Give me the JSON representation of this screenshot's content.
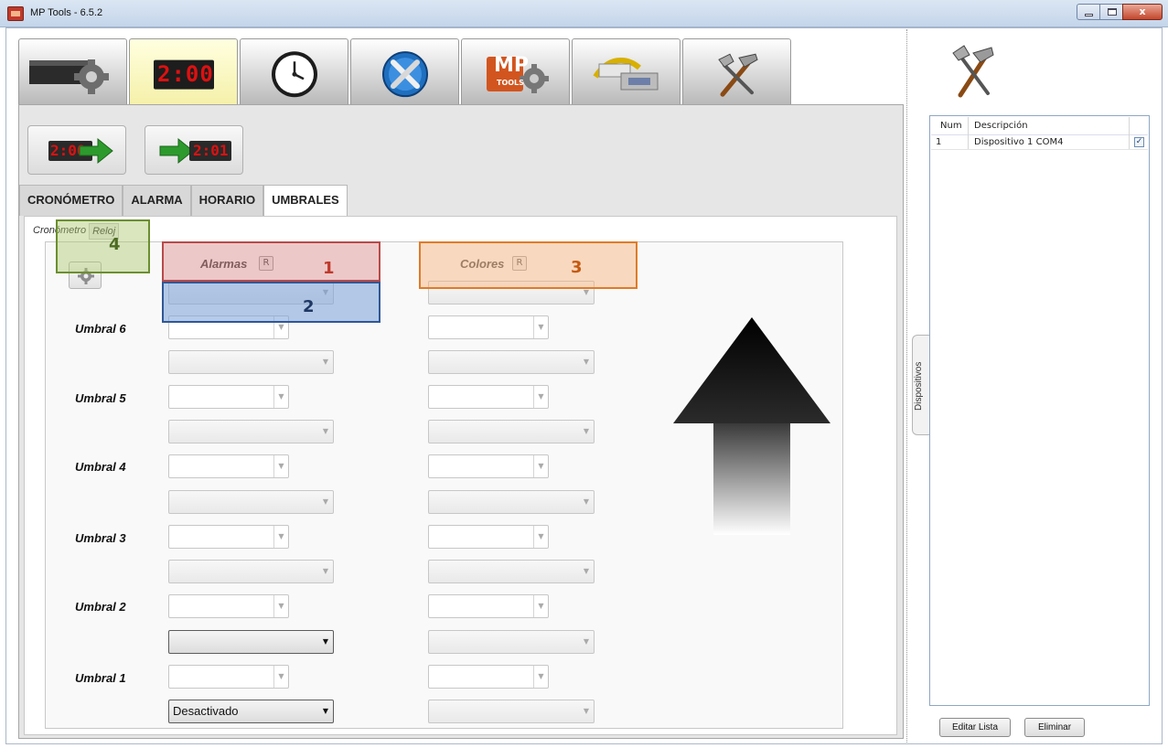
{
  "window": {
    "title": "MP Tools - 6.5.2",
    "close_glyph": "x"
  },
  "main_tabs": [
    {
      "name": "display-settings",
      "icon": "led-gear-icon"
    },
    {
      "name": "chronometer-display",
      "icon": "led-display-icon",
      "led_text": "2:00",
      "active": true
    },
    {
      "name": "clock",
      "icon": "clock-icon"
    },
    {
      "name": "tools",
      "icon": "wrench-screwdriver-icon"
    },
    {
      "name": "mp-tools",
      "icon": "mp-tools-logo-icon",
      "logo_text": "MP",
      "logo_sub": "TOOLS"
    },
    {
      "name": "connection",
      "icon": "serial-cable-icon"
    },
    {
      "name": "hammer",
      "icon": "hammer-icon"
    }
  ],
  "toolbar": {
    "left_led": "2:00",
    "right_led": "2:01"
  },
  "section_tabs": [
    {
      "label": "CRONÓMETRO"
    },
    {
      "label": "ALARMA"
    },
    {
      "label": "HORARIO"
    },
    {
      "label": "UMBRALES",
      "active": true
    }
  ],
  "inner_tabs": {
    "cronometro": "Cronómetro",
    "reloj": "Reloj"
  },
  "headers": {
    "alarmas": "Alarmas",
    "colores": "Colores",
    "reset": "R"
  },
  "umbrales": [
    {
      "label": "Umbral 6"
    },
    {
      "label": "Umbral 5"
    },
    {
      "label": "Umbral 4"
    },
    {
      "label": "Umbral 3"
    },
    {
      "label": "Umbral 2"
    },
    {
      "label": "Umbral 1",
      "selected_value": "Desactivado"
    }
  ],
  "annotations": [
    {
      "num": "1",
      "color": "#c0392b"
    },
    {
      "num": "2",
      "color": "#1f3864"
    },
    {
      "num": "3",
      "color": "#c55a11"
    },
    {
      "num": "4",
      "color": "#4e6b24"
    }
  ],
  "devices": {
    "columns": [
      "Num",
      "Descripción"
    ],
    "rows": [
      {
        "num": "1",
        "description": "Dispositivo 1 COM4",
        "checked": true
      }
    ],
    "side_tab": "Dispositivos",
    "edit_button": "Editar Lista",
    "delete_button": "Eliminar",
    "check_glyph": "✓"
  }
}
